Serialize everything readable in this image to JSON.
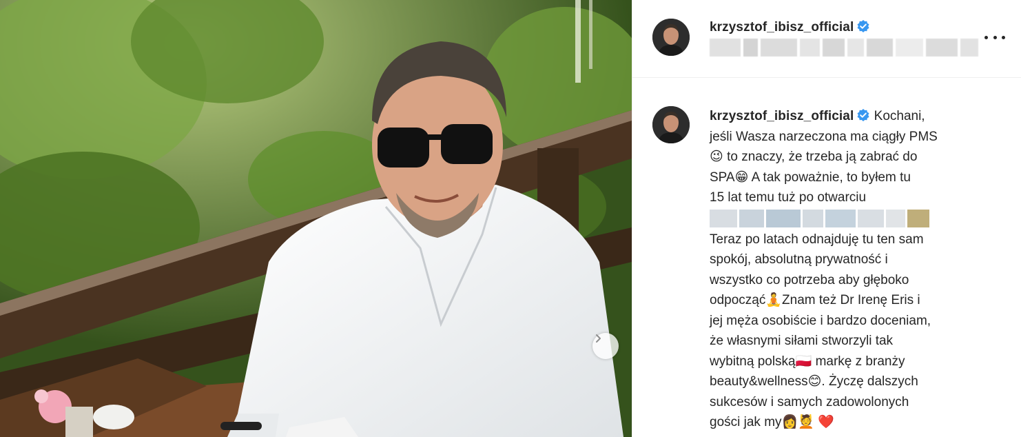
{
  "post": {
    "username": "krzysztof_ibisz_official",
    "verified_icon": "verified-badge-icon",
    "more_icon": "more-options-icon",
    "carousel_icon": "chevron-right-icon"
  },
  "caption": {
    "username": "krzysztof_ibisz_official",
    "line1": "Kochani,",
    "line2": "jeśli Wasza narzeczona ma ciągły PMS",
    "line3": "to znaczy, że trzeba ją zabrać do",
    "line4": "SPA",
    "line4b": "A tak poważnie, to byłem tu",
    "line5": "15 lat temu tuż po otwarciu",
    "line6": "Teraz po latach odnajduję tu ten sam",
    "line7": "spokój, absolutną prywatność i",
    "line8": "wszystko co potrzeba aby głęboko",
    "line9": "odpocząć",
    "line9b": "Znam też Dr Irenę Eris i",
    "line10": "jej męża osobiście i bardzo doceniam,",
    "line11": "że własnymi siłami stworzyli tak",
    "line12": "wybitną polską",
    "line12b": "markę z branży",
    "line13": "beauty&wellness",
    "line13b": ". Życzę dalszych",
    "line14": "sukcesów i samych zadowolonych",
    "line15": "gości jak my",
    "emoji_wink": "😉",
    "emoji_grin": "😁",
    "emoji_lotus": "🧘",
    "emoji_flag": "🇵🇱",
    "emoji_smile": "😊",
    "emoji_woman": "👩",
    "emoji_massage": "💆",
    "emoji_heart": "❤️"
  },
  "colors": {
    "verified_blue": "#3897f0",
    "heart_red": "#e8283f",
    "blur_gray": "#d9d9d9"
  }
}
